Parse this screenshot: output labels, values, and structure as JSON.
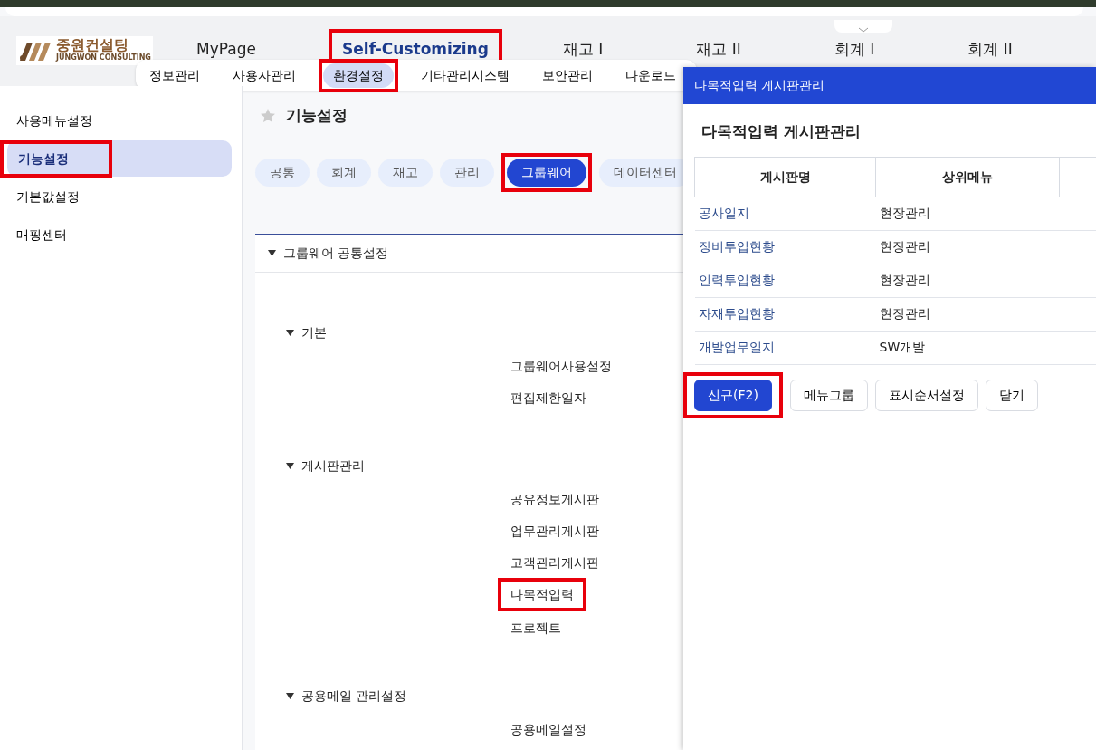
{
  "logo": {
    "name": "중원컨설팅",
    "subtitle": "JUNGWON CONSULTING"
  },
  "top_menu": [
    {
      "label": "MyPage",
      "selected": false,
      "highlighted": false
    },
    {
      "label": "Self-Customizing",
      "selected": true,
      "highlighted": true
    },
    {
      "label": "재고 I",
      "selected": false,
      "highlighted": false
    },
    {
      "label": "재고 II",
      "selected": false,
      "highlighted": false
    },
    {
      "label": "회계 I",
      "selected": false,
      "highlighted": false
    },
    {
      "label": "회계 II",
      "selected": false,
      "highlighted": false
    }
  ],
  "sub_menu": [
    {
      "label": "정보관리",
      "selected": false,
      "highlighted": false
    },
    {
      "label": "사용자관리",
      "selected": false,
      "highlighted": false
    },
    {
      "label": "환경설정",
      "selected": true,
      "highlighted": true
    },
    {
      "label": "기타관리시스템",
      "selected": false,
      "highlighted": false
    },
    {
      "label": "보안관리",
      "selected": false,
      "highlighted": false
    },
    {
      "label": "다운로드",
      "selected": false,
      "highlighted": false
    }
  ],
  "sidebar": {
    "items": [
      {
        "label": "사용메뉴설정",
        "selected": false,
        "highlighted": false
      },
      {
        "label": "기능설정",
        "selected": true,
        "highlighted": true
      },
      {
        "label": "기본값설정",
        "selected": false,
        "highlighted": false
      },
      {
        "label": "매핑센터",
        "selected": false,
        "highlighted": false
      }
    ]
  },
  "page": {
    "title": "기능설정",
    "tabs": [
      {
        "label": "공통",
        "selected": false,
        "highlighted": false
      },
      {
        "label": "회계",
        "selected": false,
        "highlighted": false
      },
      {
        "label": "재고",
        "selected": false,
        "highlighted": false
      },
      {
        "label": "관리",
        "selected": false,
        "highlighted": false
      },
      {
        "label": "그룹웨어",
        "selected": true,
        "highlighted": true
      },
      {
        "label": "데이터센터",
        "selected": false,
        "highlighted": false
      }
    ],
    "section": {
      "label": "그룹웨어 공통설정",
      "expanded": true,
      "children": [
        {
          "label": "기본",
          "expanded": true,
          "children": [
            {
              "label": "그룹웨어사용설정",
              "highlighted": false
            },
            {
              "label": "편집제한일자",
              "highlighted": false
            }
          ]
        },
        {
          "label": "게시판관리",
          "expanded": true,
          "children": [
            {
              "label": "공유정보게시판",
              "highlighted": false
            },
            {
              "label": "업무관리게시판",
              "highlighted": false
            },
            {
              "label": "고객관리게시판",
              "highlighted": false
            },
            {
              "label": "다목적입력",
              "highlighted": true
            },
            {
              "label": "프로젝트",
              "highlighted": false
            }
          ]
        },
        {
          "label": "공용메일 관리설정",
          "expanded": true,
          "children": [
            {
              "label": "공용메일설정",
              "highlighted": false
            }
          ]
        }
      ]
    }
  },
  "panel": {
    "title_bar": "다목적입력 게시판관리",
    "heading": "다목적입력 게시판관리",
    "table": {
      "columns": [
        "게시판명",
        "상위메뉴"
      ],
      "rows": [
        [
          "공사일지",
          "현장관리"
        ],
        [
          "장비투입현황",
          "현장관리"
        ],
        [
          "인력투입현황",
          "현장관리"
        ],
        [
          "자재투입현황",
          "현장관리"
        ],
        [
          "개발업무일지",
          "SW개발"
        ]
      ]
    },
    "buttons": [
      {
        "label": "신규(F2)",
        "primary": true,
        "highlighted": true
      },
      {
        "label": "메뉴그룹",
        "primary": false,
        "highlighted": false
      },
      {
        "label": "표시순서설정",
        "primary": false,
        "highlighted": false
      },
      {
        "label": "닫기",
        "primary": false,
        "highlighted": false
      }
    ]
  }
}
